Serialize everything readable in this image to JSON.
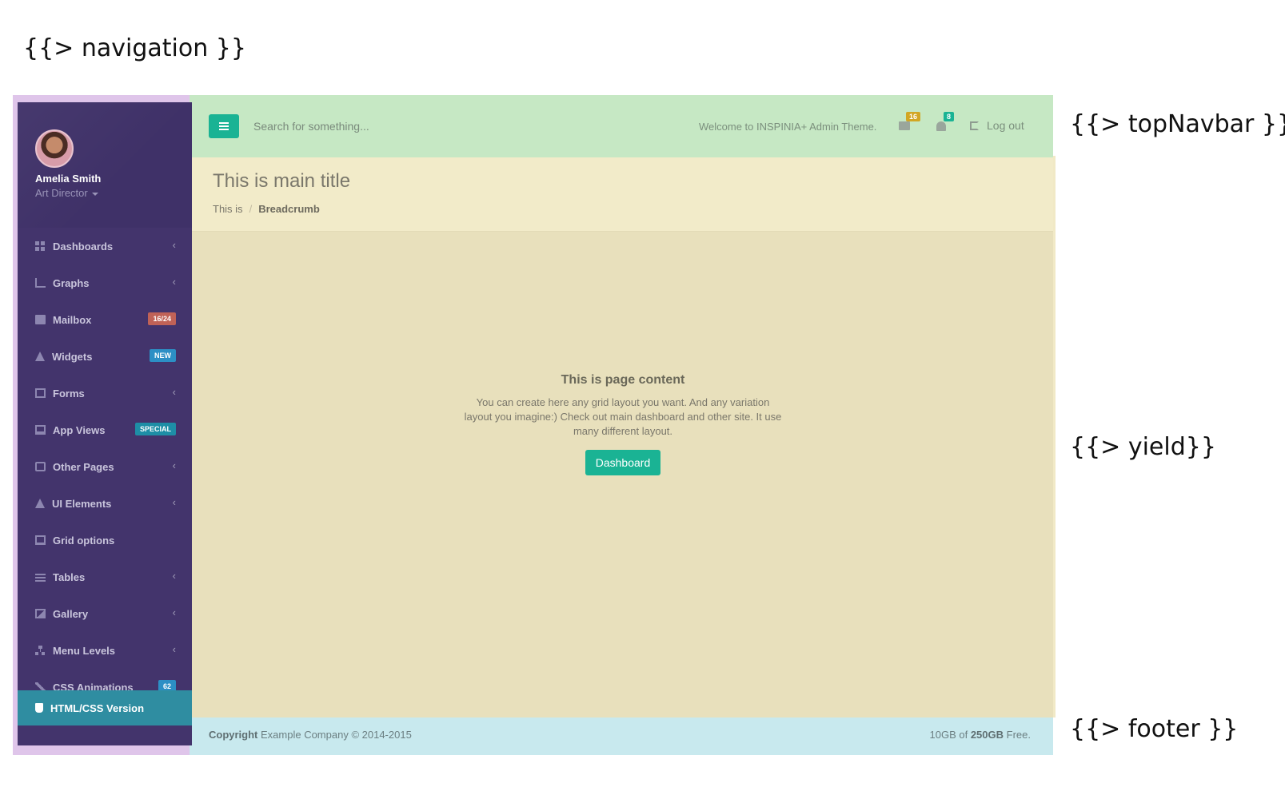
{
  "annotations": {
    "navigation": "{{> navigation }}",
    "topNavbar": "{{> topNavbar }}",
    "yield": "{{> yield}}",
    "footer": "{{> footer }}"
  },
  "profile": {
    "name": "Amelia Smith",
    "role": "Art Director"
  },
  "sidebar": {
    "items": [
      {
        "label": "Dashboards",
        "icon": "th-large-icon"
      },
      {
        "label": "Graphs",
        "icon": "bar-chart-icon"
      },
      {
        "label": "Mailbox",
        "icon": "envelope-icon",
        "badge": "16/24"
      },
      {
        "label": "Widgets",
        "icon": "flask-icon",
        "badge": "NEW"
      },
      {
        "label": "Forms",
        "icon": "edit-icon"
      },
      {
        "label": "App Views",
        "icon": "desktop-icon",
        "badge": "SPECIAL"
      },
      {
        "label": "Other Pages",
        "icon": "files-icon"
      },
      {
        "label": "UI Elements",
        "icon": "flask-icon"
      },
      {
        "label": "Grid options",
        "icon": "laptop-icon"
      },
      {
        "label": "Tables",
        "icon": "table-icon"
      },
      {
        "label": "Gallery",
        "icon": "picture-icon"
      },
      {
        "label": "Menu Levels",
        "icon": "sitemap-icon"
      },
      {
        "label": "CSS Animations",
        "icon": "magic-icon",
        "badge": "62"
      }
    ],
    "footer_item": {
      "label": "HTML/CSS Version",
      "icon": "html5-icon"
    }
  },
  "topbar": {
    "search_placeholder": "Search for something...",
    "welcome": "Welcome to INSPINIA+ Admin Theme.",
    "messages_count": "16",
    "alerts_count": "8",
    "logout": "Log out"
  },
  "heading": {
    "title": "This is main title",
    "breadcrumb": [
      "This is",
      "Breadcrumb"
    ]
  },
  "content": {
    "title": "This is page content",
    "text": "You can create here any grid layout you want. And any variation layout you imagine:) Check out main dashboard and other site. It use many different layout.",
    "button": "Dashboard"
  },
  "footer": {
    "copyright_label": "Copyright",
    "copyright_text": " Example Company © 2014-2015",
    "storage_prefix": "10GB of ",
    "storage_bold": "250GB",
    "storage_suffix": " Free."
  },
  "colors": {
    "sidebar_bg": "#43346c",
    "accent_green": "#1ab394",
    "badge_orange": "#c06257",
    "badge_blue": "#2c8fc5",
    "badge_teal": "#1e8ea6",
    "badge_yellow": "#d2a623"
  }
}
